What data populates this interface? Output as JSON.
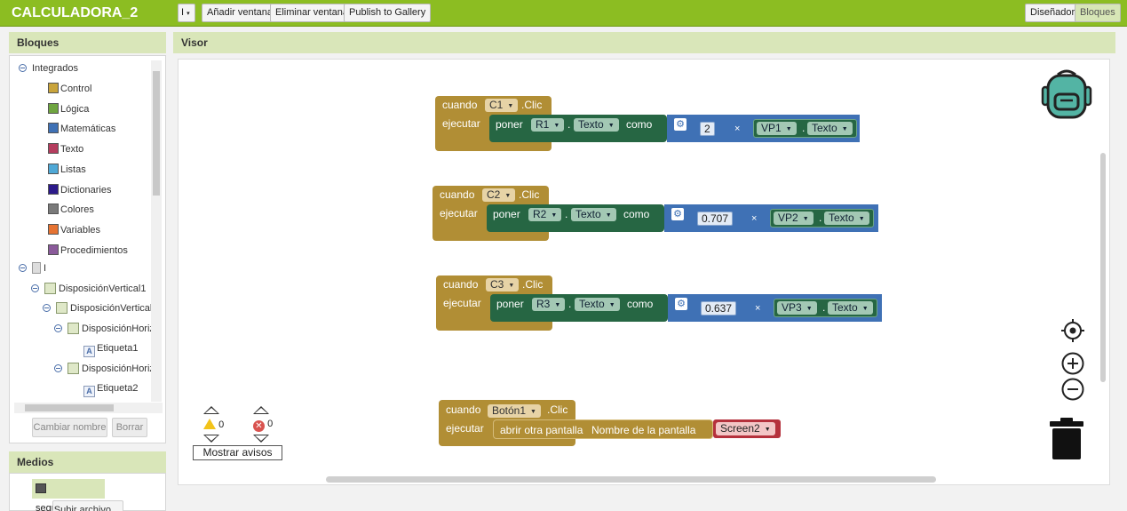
{
  "app": {
    "title": "CALCULADORA_2"
  },
  "toolbar": {
    "screen_select": "I",
    "add_window": "Añadir ventana",
    "remove_window": "Eliminar ventana",
    "publish": "Publish to Gallery",
    "designer": "Diseñador",
    "blocks": "Bloques"
  },
  "blocks_panel": {
    "title": "Bloques",
    "builtin": {
      "label": "Integrados",
      "items": [
        {
          "label": "Control",
          "color": "#c9a43b"
        },
        {
          "label": "Lógica",
          "color": "#6fa540"
        },
        {
          "label": "Matemáticas",
          "color": "#3f71b5"
        },
        {
          "label": "Texto",
          "color": "#b53d5e"
        },
        {
          "label": "Listas",
          "color": "#4fa8d6"
        },
        {
          "label": "Dictionaries",
          "color": "#2c1a8a"
        },
        {
          "label": "Colores",
          "color": "#7a7a7a"
        },
        {
          "label": "Variables",
          "color": "#e67332"
        },
        {
          "label": "Procedimientos",
          "color": "#8a5a9a"
        }
      ]
    },
    "screen": "I",
    "components": [
      {
        "label": "DisposiciónVertical1",
        "kind": "comp"
      },
      {
        "label": "DisposiciónVertical",
        "kind": "comp"
      },
      {
        "label": "DisposiciónHoriz",
        "kind": "comp"
      },
      {
        "label": "Etiqueta1",
        "kind": "label"
      },
      {
        "label": "DisposiciónHoriz",
        "kind": "comp"
      },
      {
        "label": "Etiqueta2",
        "kind": "label"
      }
    ],
    "rename_button": "Cambiar nombre",
    "delete_button": "Borrar"
  },
  "media_panel": {
    "title": "Medios",
    "file": "segunda.png",
    "upload_button": "Subir archivo ..."
  },
  "viewer": {
    "title": "Visor",
    "blocks": [
      {
        "when": "cuando",
        "component": "C1",
        "event": ".Clic",
        "do": "ejecutar",
        "set": "poner",
        "target": "R1",
        "dot": ".",
        "prop": "Texto",
        "to": "como",
        "num": "2",
        "op": "×",
        "source": "VP1",
        "source_prop": "Texto"
      },
      {
        "when": "cuando",
        "component": "C2",
        "event": ".Clic",
        "do": "ejecutar",
        "set": "poner",
        "target": "R2",
        "dot": ".",
        "prop": "Texto",
        "to": "como",
        "num": "0.707",
        "op": "×",
        "source": "VP2",
        "source_prop": "Texto"
      },
      {
        "when": "cuando",
        "component": "C3",
        "event": ".Clic",
        "do": "ejecutar",
        "set": "poner",
        "target": "R3",
        "dot": ".",
        "prop": "Texto",
        "to": "como",
        "num": "0.637",
        "op": "×",
        "source": "VP3",
        "source_prop": "Texto"
      }
    ],
    "button_block": {
      "when": "cuando",
      "component": "Botón1",
      "event": ".Clic",
      "do": "ejecutar",
      "action": "abrir otra pantalla",
      "arg": "Nombre de la pantalla",
      "screen": "Screen2"
    },
    "warnings": {
      "warn_count": "0",
      "error_count": "0",
      "show_button": "Mostrar avisos"
    }
  }
}
